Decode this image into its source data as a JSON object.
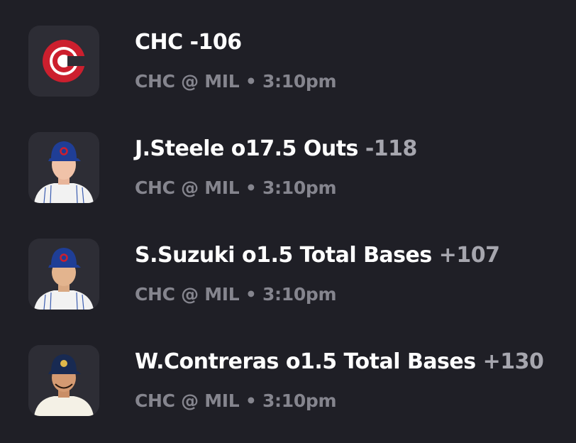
{
  "colors": {
    "background": "#1f1f26",
    "avatar_background": "#2d2d35",
    "title": "#ffffff",
    "odds": "#a6a6ae",
    "subtitle": "#85858e",
    "cubs_red": "#cc1f2e",
    "cubs_blue": "#1f3e96"
  },
  "bets": [
    {
      "icon": "cubs-logo-icon",
      "player": "CHC",
      "odds": "-106",
      "game": "CHC @ MIL",
      "separator": "•",
      "time": "3:10pm"
    },
    {
      "icon": "player-headshot-steele",
      "player": "J.Steele o17.5 Outs",
      "odds": "-118",
      "game": "CHC @ MIL",
      "separator": "•",
      "time": "3:10pm"
    },
    {
      "icon": "player-headshot-suzuki",
      "player": "S.Suzuki o1.5 Total Bases",
      "odds": "+107",
      "game": "CHC @ MIL",
      "separator": "•",
      "time": "3:10pm"
    },
    {
      "icon": "player-headshot-contreras",
      "player": "W.Contreras o1.5 Total Bases",
      "odds": "+130",
      "game": "CHC @ MIL",
      "separator": "•",
      "time": "3:10pm"
    }
  ]
}
